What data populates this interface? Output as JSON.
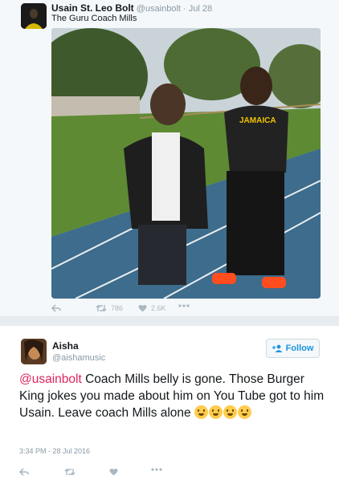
{
  "tweet": {
    "author_name": "Usain St. Leo Bolt",
    "author_handle": "@usainbolt",
    "separator": "·",
    "date": "Jul 28",
    "text": "The Guru Coach Mills",
    "retweet_count": "786",
    "like_count": "2.6K"
  },
  "reply": {
    "author_name": "Aisha",
    "author_handle": "@aishamusic",
    "follow_label": "Follow",
    "mention": "@usainbolt",
    "text": " Coach Mills belly is gone. Those Burger King jokes you made about him on You Tube got to him Usain. Leave coach Mills alone ",
    "timestamp": "3:34 PM - 28 Jul 2016",
    "emojis": [
      "tongue-face",
      "kiss-face",
      "wink-face",
      "laughing-face"
    ]
  },
  "colors": {
    "accent": "#1b95e0",
    "mention": "#e0245e",
    "muted": "#8899a6",
    "background": "#e6ecf0"
  }
}
